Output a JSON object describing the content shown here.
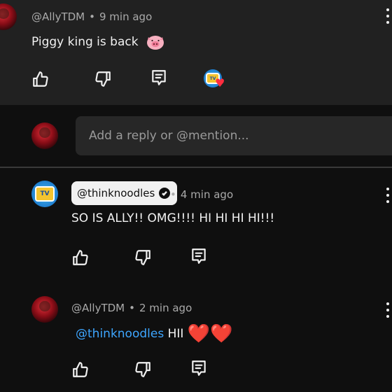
{
  "comment_top": {
    "author": "@AllyTDM",
    "separator": "•",
    "time": "9 min ago",
    "text": "Piggy king is back",
    "emoji_icon": "pig-face-emoji",
    "actions": {
      "like_icon": "thumbs-up-icon",
      "dislike_icon": "thumbs-down-icon",
      "reply_icon": "reply-comment-icon",
      "creator_heart_icon": "creator-heart-badge"
    }
  },
  "reply_box": {
    "placeholder": "Add a reply or @mention..."
  },
  "reply_1": {
    "author_chip": "@thinknoodles",
    "verified_icon": "verified-check-icon",
    "separator": "•",
    "time": "4 min ago",
    "text": "SO IS ALLY!! OMG!!!! HI HI HI HI!!!"
  },
  "reply_2": {
    "author": "@AllyTDM",
    "separator": "•",
    "time": "2 min ago",
    "mention": "@thinknoodles",
    "text": "HII",
    "hearts": "❤️❤️"
  },
  "colors": {
    "background": "#0f0f0f",
    "top_block": "#212121",
    "input_bg": "#272727",
    "mention": "#3ea6ff",
    "heart": "#e0142b"
  }
}
